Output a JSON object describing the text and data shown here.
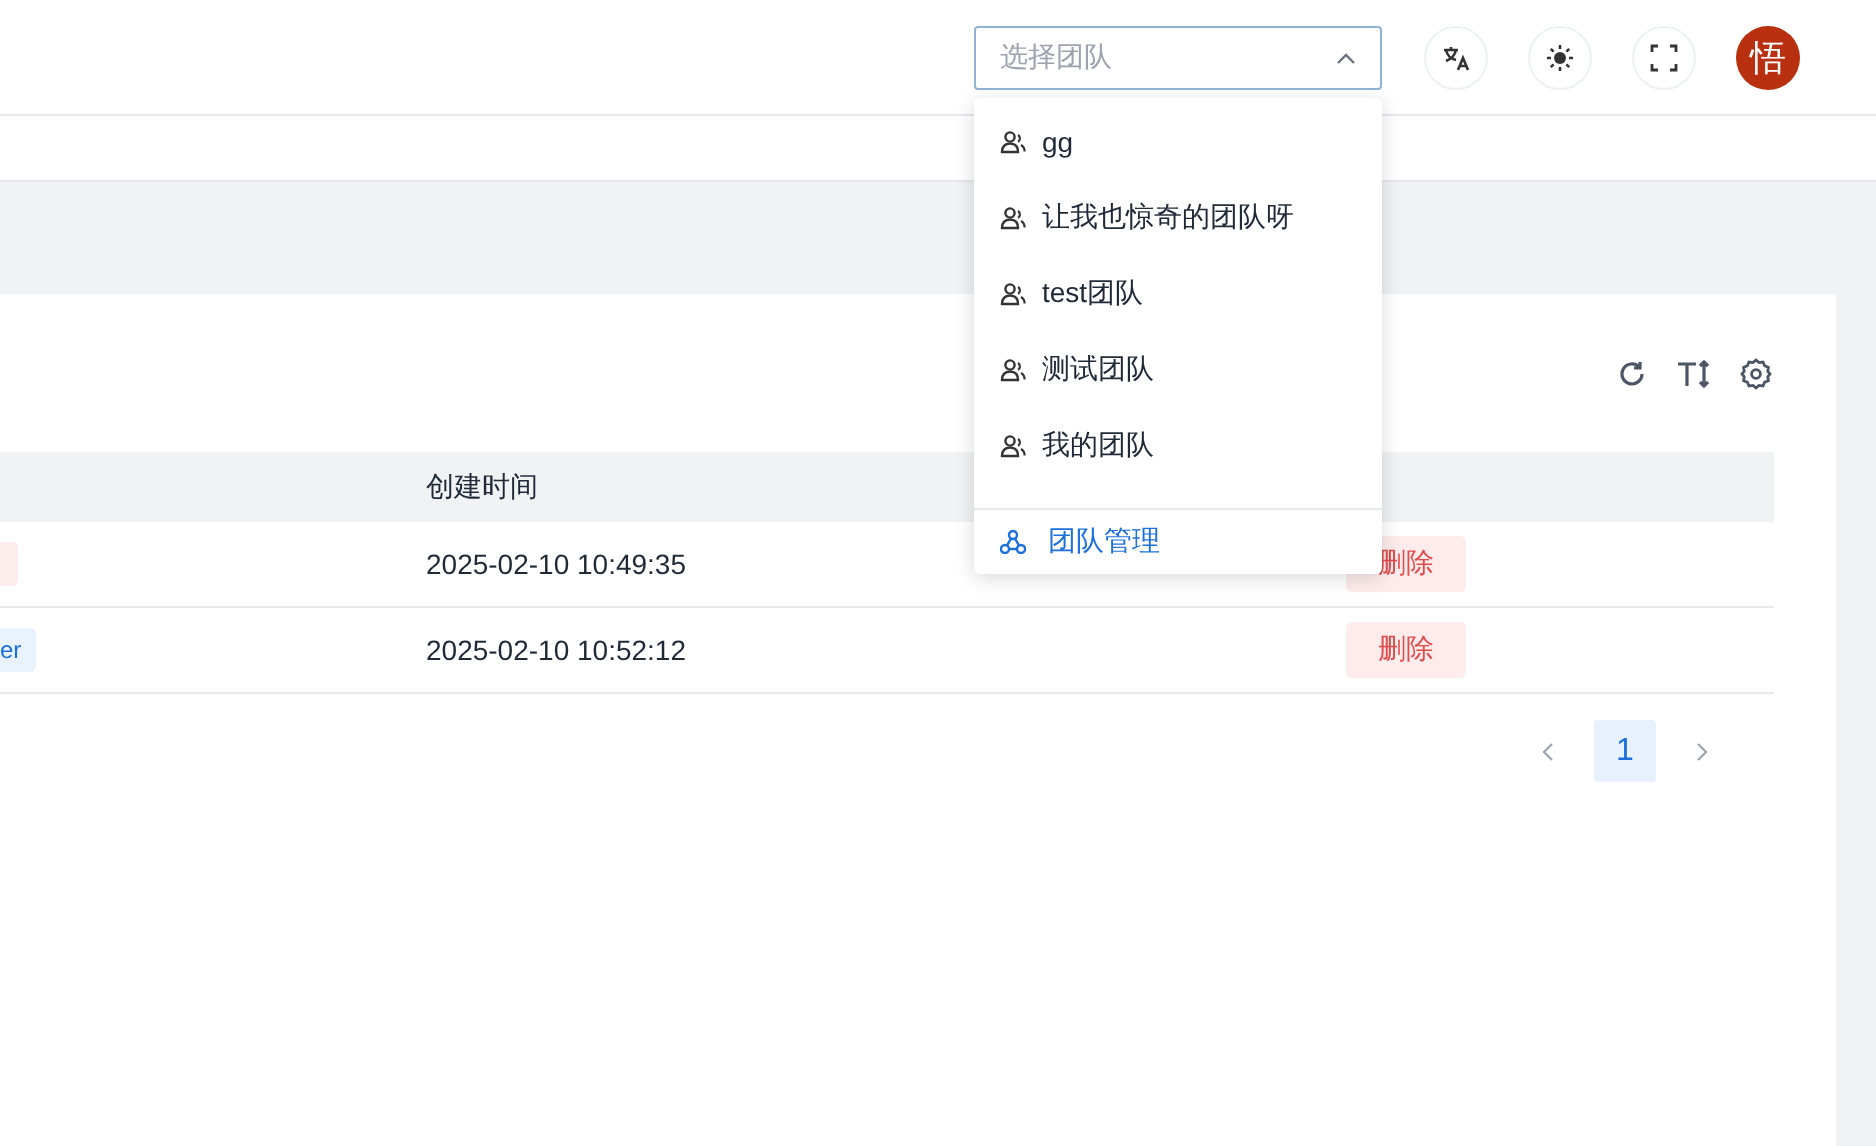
{
  "header": {
    "team_select": {
      "placeholder": "选择团队",
      "expanded": true
    },
    "avatar": {
      "text": "悟"
    }
  },
  "team_menu": {
    "items": [
      {
        "label": "gg",
        "selected": false
      },
      {
        "label": "让我也惊奇的团队呀",
        "selected": false
      },
      {
        "label": "test团队",
        "selected": false
      },
      {
        "label": "测试团队",
        "selected": false
      },
      {
        "label": "我的团队",
        "selected": false
      }
    ],
    "footer": {
      "label": "团队管理"
    }
  },
  "table": {
    "column_2": "创建时间",
    "rows": [
      {
        "column_1": {
          "color": "#fdecec"
        },
        "created": "2025-02-10 10:49:35",
        "action": "删除"
      },
      {
        "column_1": {
          "text": "er",
          "color": "#e8f3ff"
        },
        "created": "2025-02-10 10:52:12",
        "action": "删除"
      }
    ]
  },
  "pagination": {
    "pages": [
      {
        "label": "1",
        "selected": true
      }
    ]
  }
}
